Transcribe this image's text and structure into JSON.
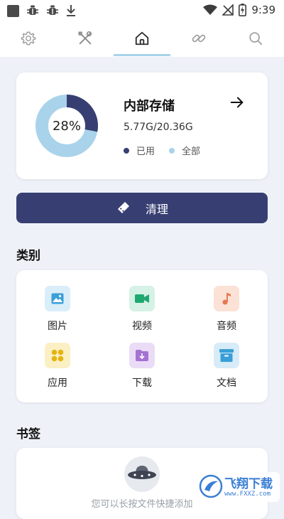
{
  "status_bar": {
    "time": "9:39",
    "icons": [
      "notification-square-icon",
      "bug-icon",
      "bug-icon",
      "download-icon",
      "wifi-icon",
      "no-signal-icon",
      "battery-charging-icon"
    ]
  },
  "tabs": [
    {
      "name": "settings",
      "icon": "gear-icon"
    },
    {
      "name": "tools",
      "icon": "tools-icon"
    },
    {
      "name": "home",
      "icon": "home-icon",
      "active": true
    },
    {
      "name": "link",
      "icon": "link-icon"
    },
    {
      "name": "search",
      "icon": "search-icon"
    }
  ],
  "storage": {
    "title": "内部存储",
    "percent_label": "28%",
    "used_fraction": 0.28,
    "size_text": "5.77G/20.36G",
    "legend_used": "已用",
    "legend_total": "全部",
    "colors": {
      "used": "#373f72",
      "total": "#a9d3ea"
    }
  },
  "clean_button": {
    "label": "清理",
    "icon": "broom-icon"
  },
  "categories": {
    "title": "类别",
    "items": [
      {
        "label": "图片",
        "icon": "image-icon",
        "bg": "#d9eef9",
        "fg": "#3a9fd8"
      },
      {
        "label": "视频",
        "icon": "video-icon",
        "bg": "#d6f1e6",
        "fg": "#1fa971"
      },
      {
        "label": "音频",
        "icon": "music-icon",
        "bg": "#fbe1d6",
        "fg": "#e37a4f"
      },
      {
        "label": "应用",
        "icon": "apps-icon",
        "bg": "#fbf0c4",
        "fg": "#e5b50f"
      },
      {
        "label": "下载",
        "icon": "download-folder-icon",
        "bg": "#eadcf6",
        "fg": "#a572d2"
      },
      {
        "label": "文档",
        "icon": "archive-icon",
        "bg": "#d7ecf8",
        "fg": "#3a9fd8"
      }
    ]
  },
  "bookmarks": {
    "title": "书签",
    "empty_text": "您可以长按文件快捷添加"
  },
  "watermark": {
    "brand": "飞翔下载",
    "url": "www.FXXZ.com"
  }
}
